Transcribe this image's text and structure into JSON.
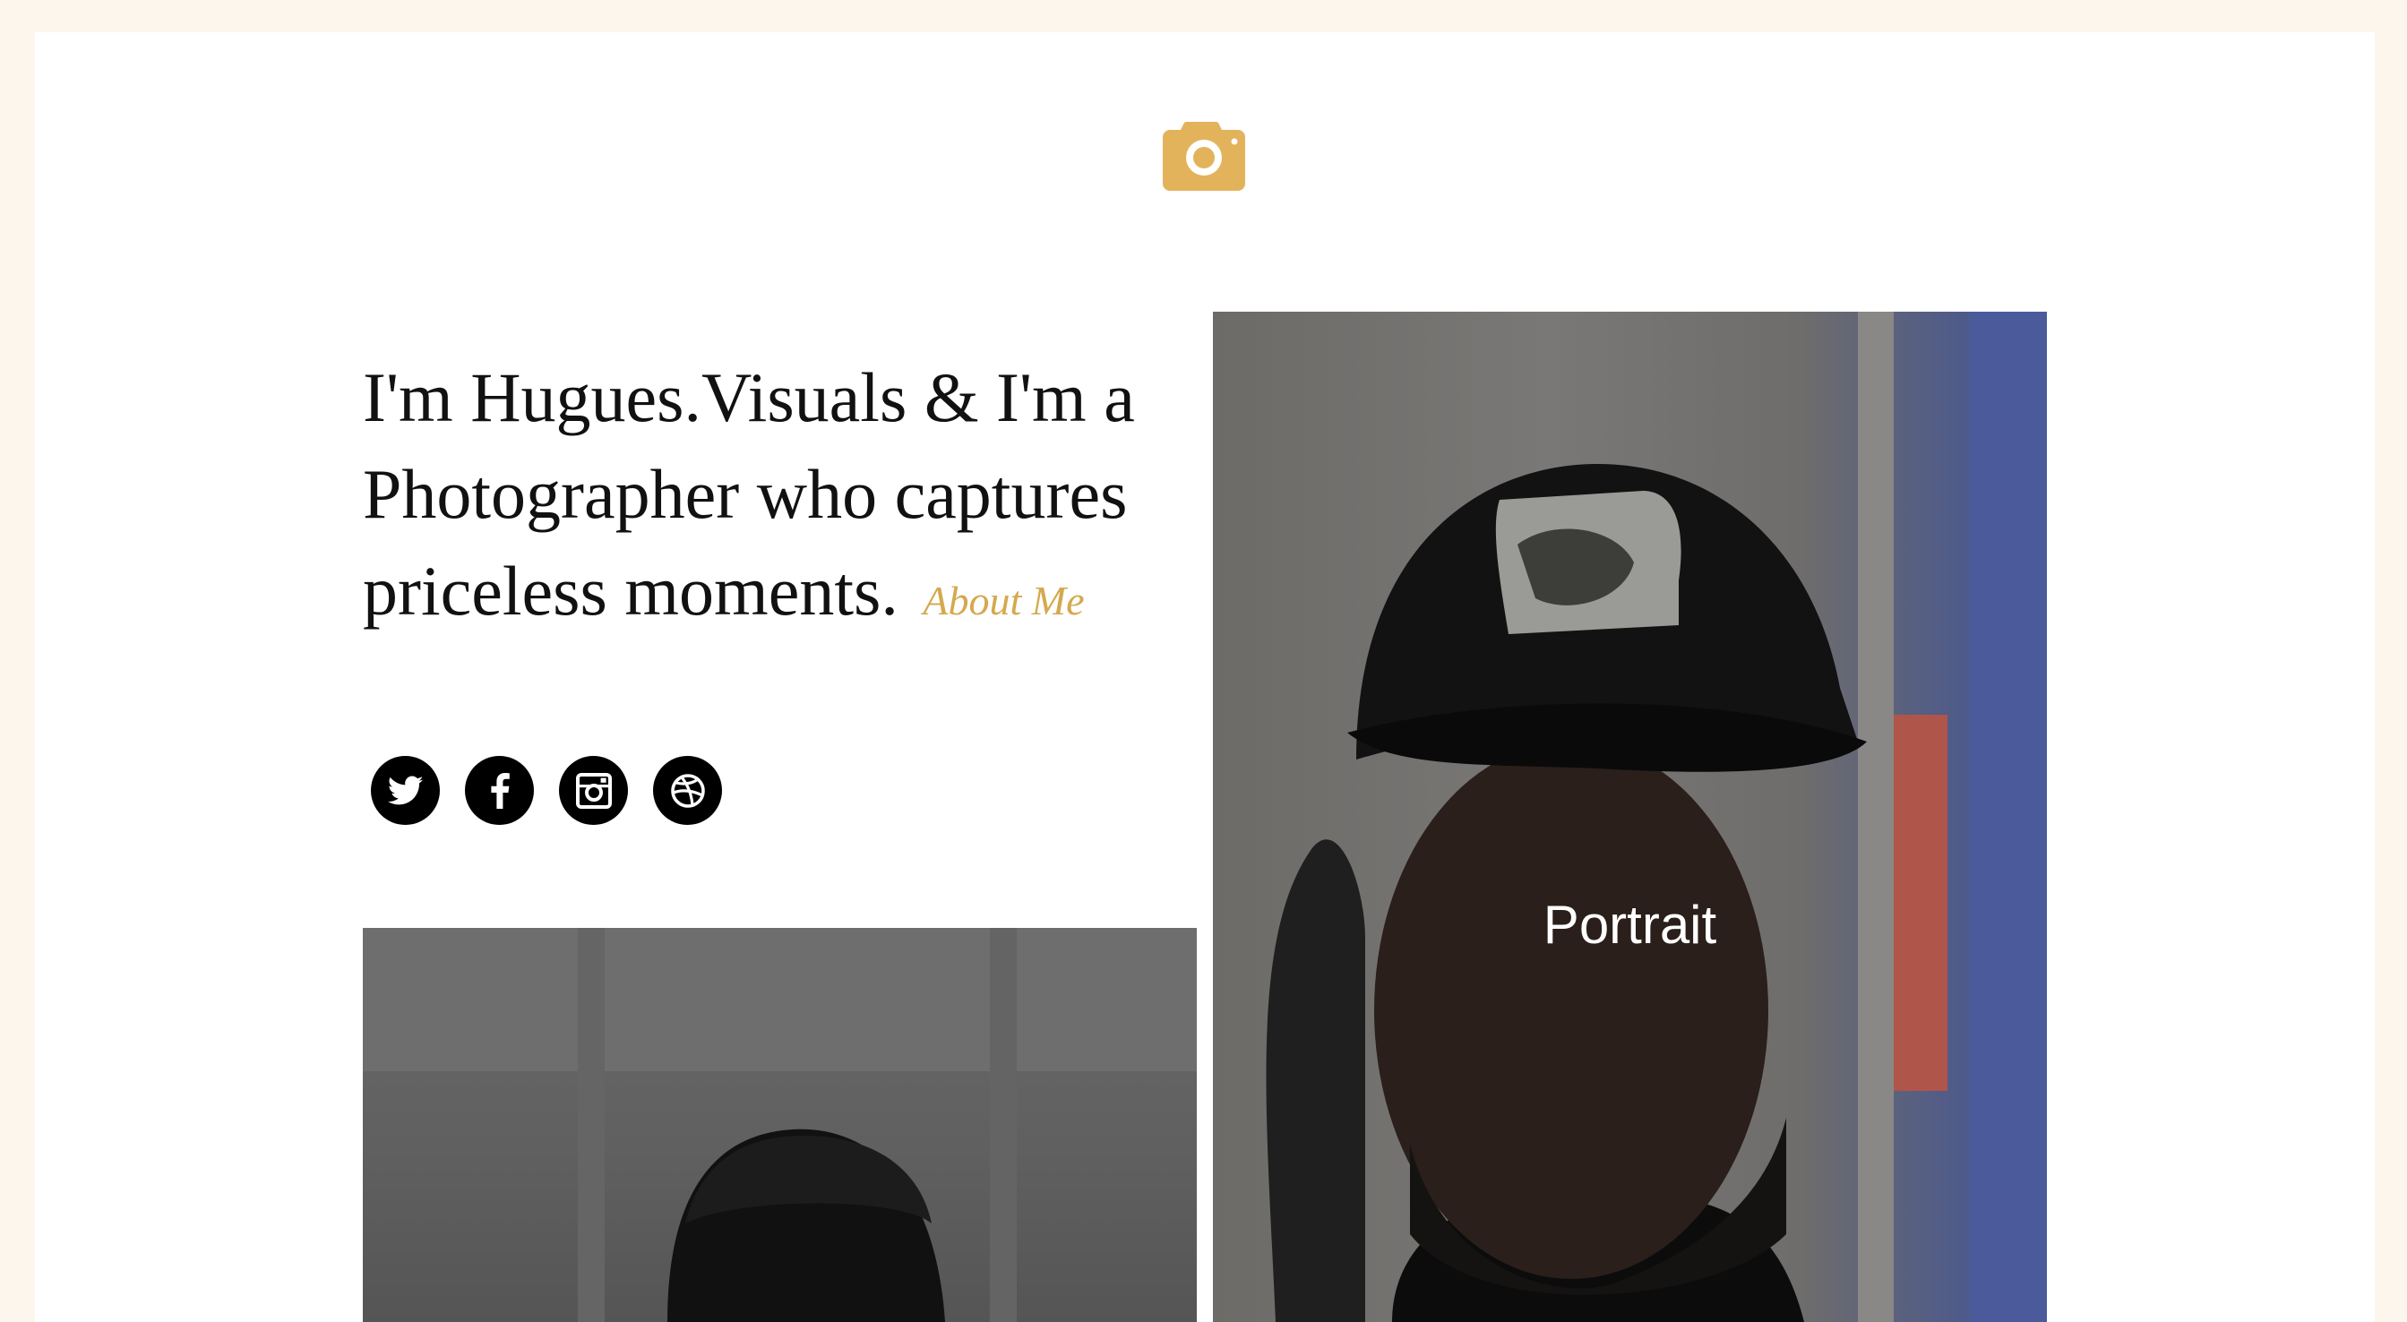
{
  "colors": {
    "accent": "#d4a94e",
    "page_bg": "#fdf6ec"
  },
  "header": {
    "logo_icon": "camera-icon"
  },
  "intro": {
    "text": "I'm Hugues.Visuals & I'm a Photographer who captures priceless moments.",
    "about_link": "About Me"
  },
  "social": [
    {
      "icon": "twitter-icon"
    },
    {
      "icon": "facebook-icon"
    },
    {
      "icon": "instagram-icon"
    },
    {
      "icon": "dribbble-icon"
    }
  ],
  "gallery": {
    "portrait_label": "Portrait"
  }
}
